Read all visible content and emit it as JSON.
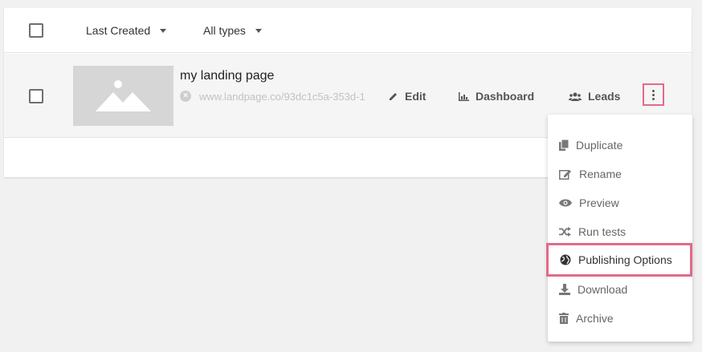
{
  "toolbar": {
    "sort_label": "Last Created",
    "type_filter_label": "All types"
  },
  "landing_page": {
    "title": "my landing page",
    "url": "www.landpage.co/93dc1c5a-353d-1",
    "actions": {
      "edit": "Edit",
      "dashboard": "Dashboard",
      "leads": "Leads"
    }
  },
  "menu": {
    "items": [
      {
        "label": "Duplicate",
        "icon": "duplicate-icon"
      },
      {
        "label": "Rename",
        "icon": "rename-icon"
      },
      {
        "label": "Preview",
        "icon": "eye-icon"
      },
      {
        "label": "Run tests",
        "icon": "shuffle-icon"
      },
      {
        "label": "Publishing Options",
        "icon": "globe-icon",
        "highlighted": true
      },
      {
        "label": "Download",
        "icon": "download-icon"
      },
      {
        "label": "Archive",
        "icon": "trash-icon"
      }
    ]
  },
  "colors": {
    "highlight": "#e36a8a",
    "thumbnail_bg": "#d6d6d6"
  }
}
